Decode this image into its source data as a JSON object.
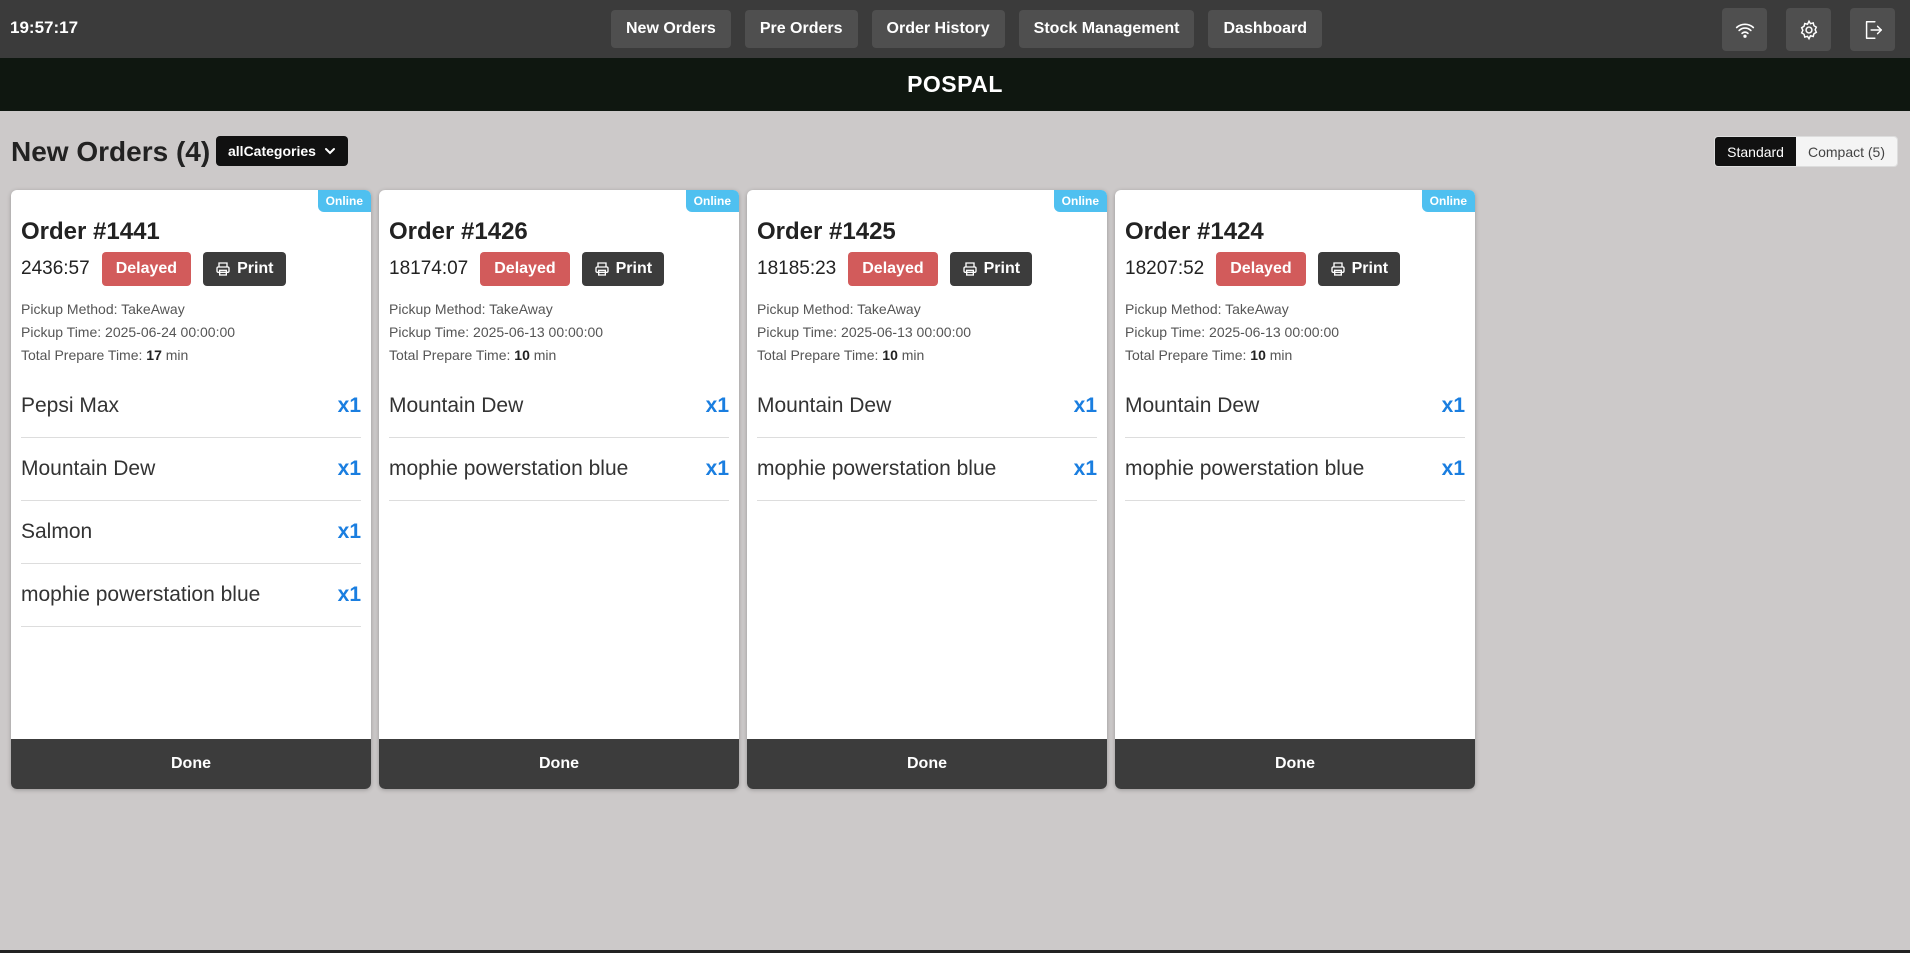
{
  "clock": "19:57:17",
  "nav": [
    "New Orders",
    "Pre Orders",
    "Order History",
    "Stock Management",
    "Dashboard"
  ],
  "icons": [
    "wifi-icon",
    "gear-icon",
    "logout-icon"
  ],
  "brand": "POSPAL",
  "heading": "New Orders (4)",
  "category_select": "allCategories",
  "view_toggle": {
    "standard": "Standard",
    "compact": "Compact (5)"
  },
  "labels": {
    "online": "Online",
    "delayed": "Delayed",
    "print": "Print",
    "done": "Done",
    "pickup_method": "Pickup Method: ",
    "pickup_time": "Pickup Time: ",
    "prepare_time": "Total Prepare Time: ",
    "min": " min"
  },
  "colors": {
    "online": "#4fc0f0",
    "delayed": "#d25b5b",
    "qty": "#1a7ee0"
  },
  "orders": [
    {
      "title": "Order #1441",
      "elapsed": "2436:57",
      "pickup_method": "TakeAway",
      "pickup_time": "2025-06-24 00:00:00",
      "prepare_time": "17",
      "items": [
        {
          "name": "Pepsi Max",
          "qty": "x1"
        },
        {
          "name": "Mountain Dew",
          "qty": "x1"
        },
        {
          "name": "Salmon",
          "qty": "x1"
        },
        {
          "name": "mophie powerstation blue",
          "qty": "x1"
        }
      ]
    },
    {
      "title": "Order #1426",
      "elapsed": "18174:07",
      "pickup_method": "TakeAway",
      "pickup_time": "2025-06-13 00:00:00",
      "prepare_time": "10",
      "items": [
        {
          "name": "Mountain Dew",
          "qty": "x1"
        },
        {
          "name": "mophie powerstation blue",
          "qty": "x1"
        }
      ]
    },
    {
      "title": "Order #1425",
      "elapsed": "18185:23",
      "pickup_method": "TakeAway",
      "pickup_time": "2025-06-13 00:00:00",
      "prepare_time": "10",
      "items": [
        {
          "name": "Mountain Dew",
          "qty": "x1"
        },
        {
          "name": "mophie powerstation blue",
          "qty": "x1"
        }
      ]
    },
    {
      "title": "Order #1424",
      "elapsed": "18207:52",
      "pickup_method": "TakeAway",
      "pickup_time": "2025-06-13 00:00:00",
      "prepare_time": "10",
      "items": [
        {
          "name": "Mountain Dew",
          "qty": "x1"
        },
        {
          "name": "mophie powerstation blue",
          "qty": "x1"
        }
      ]
    }
  ]
}
